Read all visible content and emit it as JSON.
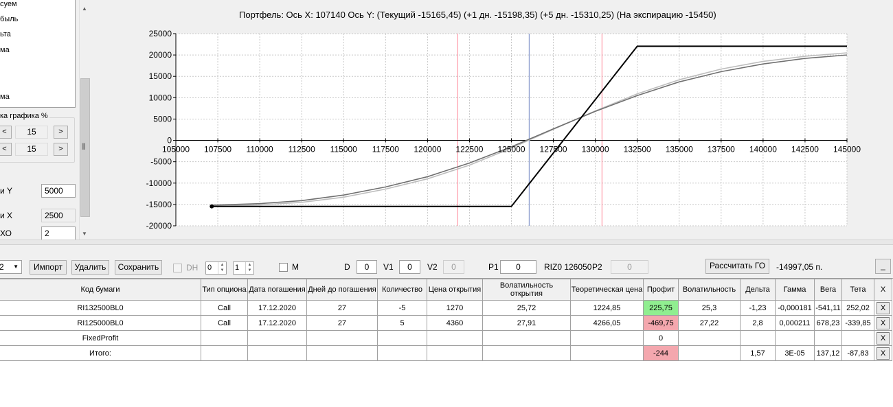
{
  "left_panel": {
    "series_items": [
      "суем",
      "быль",
      "ьта",
      "ма",
      "",
      "",
      "ма"
    ],
    "scale_group_title": "ка графика %",
    "scale_x_value": "15",
    "scale_y_value": "15",
    "btn_left": "<",
    "btn_right": ">",
    "step_y_label": "и Y",
    "step_y_value": "5000",
    "step_x_label": "и X",
    "step_x_value": "2500",
    "go_label": "ХО",
    "go_value": "2"
  },
  "chart": {
    "title": "Портфель: Ось X:  107140 Ось Y:   (Текущий -15165,45)   (+1 дн. -15198,35)   (+5 дн. -15310,25)   (На экспирацию -15450)",
    "x_ticks": [
      105000,
      107500,
      110000,
      112500,
      115000,
      117500,
      120000,
      122500,
      125000,
      127500,
      130000,
      132500,
      135000,
      137500,
      140000,
      142500,
      145000
    ],
    "y_ticks": [
      25000,
      20000,
      15000,
      10000,
      5000,
      0,
      -5000,
      -10000,
      -15000,
      -20000
    ]
  },
  "chart_data": {
    "type": "line",
    "xlim": [
      105000,
      145000
    ],
    "ylim": [
      -20000,
      25000
    ],
    "grid": true,
    "vertical_markers": [
      {
        "x": 121800,
        "color": "#ff9aa8"
      },
      {
        "x": 126060,
        "color": "#8899cc"
      },
      {
        "x": 130400,
        "color": "#ff9aa8"
      }
    ],
    "series": [
      {
        "color": "#000000",
        "x": [
          107140,
          125000,
          132500,
          145000
        ],
        "y": [
          -15450,
          -15450,
          22050,
          22050
        ]
      },
      {
        "color": "#707070",
        "x": [
          107140,
          110000,
          112500,
          115000,
          117500,
          120000,
          122500,
          125000,
          127500,
          130000,
          132500,
          135000,
          137500,
          140000,
          142500,
          145000
        ],
        "y": [
          -15165,
          -14800,
          -14100,
          -12800,
          -10900,
          -8500,
          -5300,
          -1500,
          2700,
          6800,
          10500,
          13700,
          16100,
          17900,
          19200,
          20000
        ]
      },
      {
        "color": "#bdbdbd",
        "x": [
          107140,
          110000,
          112500,
          115000,
          117500,
          120000,
          122500,
          125000,
          127500,
          130000,
          132500,
          135000,
          137500,
          140000,
          142500,
          145000
        ],
        "y": [
          -15310,
          -15100,
          -14500,
          -13300,
          -11400,
          -9000,
          -5800,
          -1800,
          2600,
          6900,
          10900,
          14200,
          16700,
          18500,
          19700,
          20500
        ]
      }
    ]
  },
  "toolbar": {
    "dropdown_value": "2",
    "import_label": "Импорт",
    "delete_label": "Удалить",
    "save_label": "Сохранить",
    "dh_label": "DH",
    "spin1_value": "0",
    "spin2_value": "1",
    "m_label": "M",
    "d_label": "D",
    "d_value": "0",
    "v1_label": "V1",
    "v1_value": "0",
    "v2_label": "V2",
    "v2_value": "0",
    "p1_label": "P1",
    "p1_value": "0",
    "riz_label": "RIZ0 126050",
    "p2_label": "P2",
    "p2_value": "0",
    "calc_go_label": "Рассчитать ГО",
    "go_total": "-14997,05 п.",
    "minimize_label": "_"
  },
  "table": {
    "headers": [
      "Код бумаги",
      "Тип опциона",
      "Дата погашения",
      "Дней до погашения",
      "Количество",
      "Цена открытия",
      "Волатильность открытия",
      "Теоретическая цена",
      "Профит",
      "Волатильность",
      "Дельта",
      "Гамма",
      "Вега",
      "Тета",
      "X"
    ],
    "rows": [
      {
        "code": "RI132500BL0",
        "type": "Call",
        "date": "17.12.2020",
        "days": "27",
        "qty": "-5",
        "open_price": "1270",
        "open_vol": "25,72",
        "theo": "1224,85",
        "profit": "225,75",
        "vol": "25,3",
        "delta": "-1,23",
        "gamma": "-0,000181",
        "vega": "-541,11",
        "theta": "252,02",
        "x": "X"
      },
      {
        "code": "RI125000BL0",
        "type": "Call",
        "date": "17.12.2020",
        "days": "27",
        "qty": "5",
        "open_price": "4360",
        "open_vol": "27,91",
        "theo": "4266,05",
        "profit": "-469,75",
        "vol": "27,22",
        "delta": "2,8",
        "gamma": "0,000211",
        "vega": "678,23",
        "theta": "-339,85",
        "x": "X"
      },
      {
        "code": "FixedProfit",
        "type": "",
        "date": "",
        "days": "",
        "qty": "",
        "open_price": "",
        "open_vol": "",
        "theo": "",
        "profit": "0",
        "vol": "",
        "delta": "",
        "gamma": "",
        "vega": "",
        "theta": "",
        "x": "X"
      },
      {
        "code": "Итого:",
        "type": "",
        "date": "",
        "days": "",
        "qty": "",
        "open_price": "",
        "open_vol": "",
        "theo": "",
        "profit": "-244",
        "vol": "",
        "delta": "1,57",
        "gamma": "3E-05",
        "vega": "137,12",
        "theta": "-87,83",
        "x": "X"
      }
    ]
  }
}
